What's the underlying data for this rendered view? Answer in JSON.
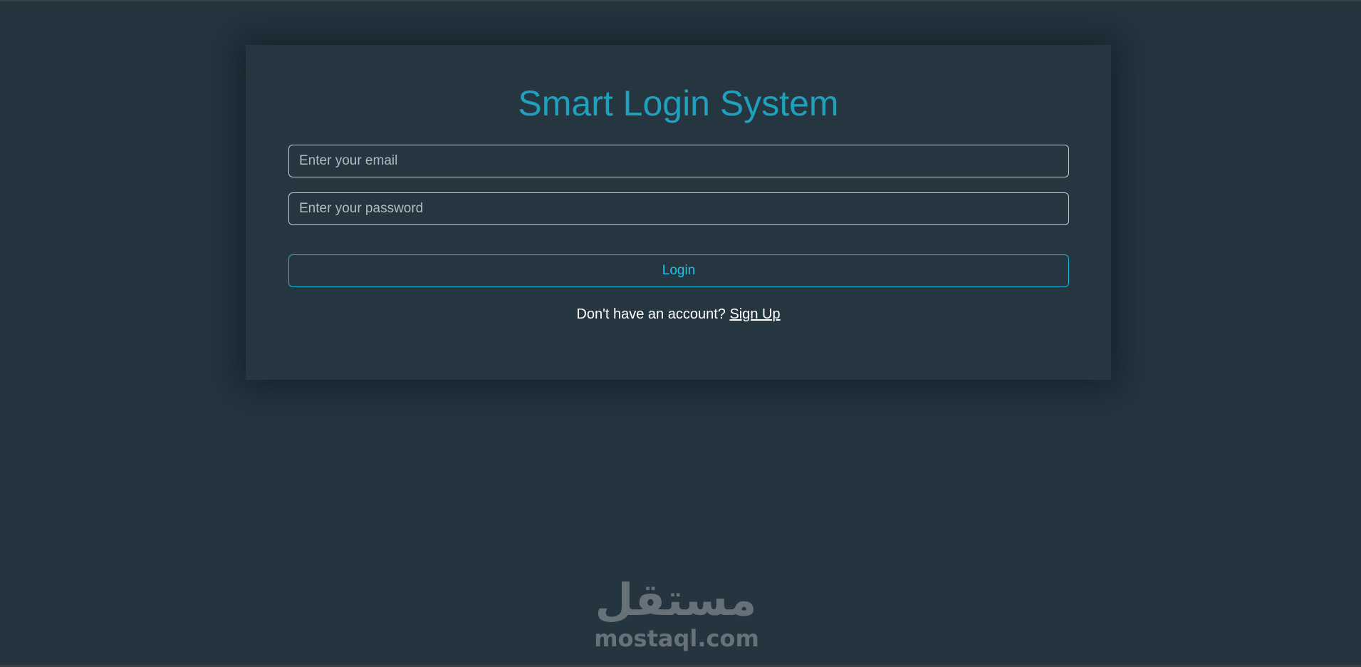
{
  "login_form": {
    "title": "Smart Login System",
    "email_placeholder": "Enter your email",
    "password_placeholder": "Enter your password",
    "login_label": "Login",
    "signup_prompt": "Don't have an account?",
    "signup_link": "Sign Up"
  },
  "watermark": {
    "arabic": "مستقل",
    "latin": "mostaql.com"
  },
  "colors": {
    "background": "#243540",
    "card": "#253641",
    "accent": "#1fa0bd",
    "button_border": "#18b6dc",
    "text": "#ffffff"
  }
}
